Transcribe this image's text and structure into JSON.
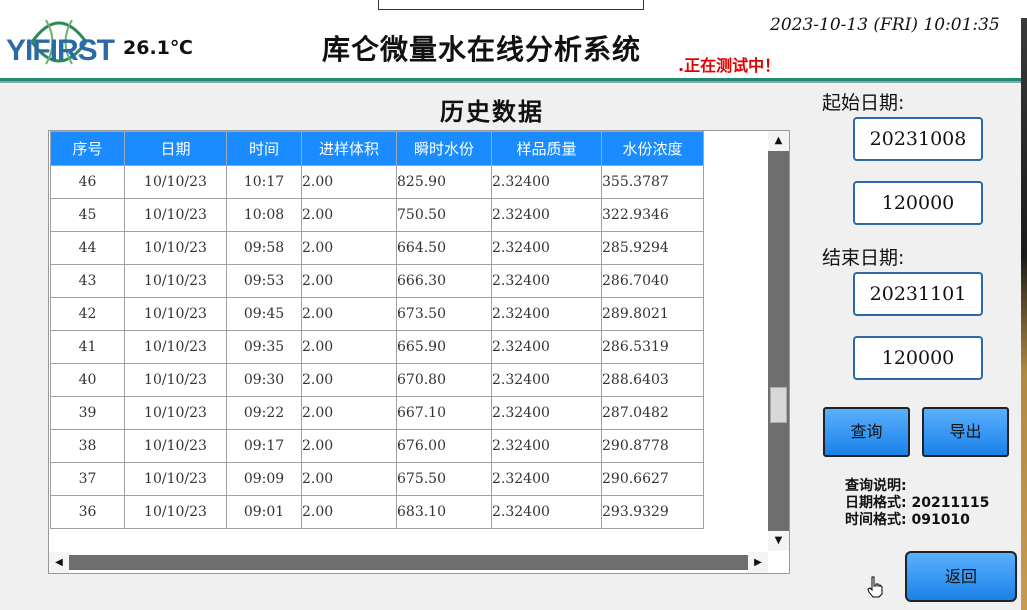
{
  "header": {
    "logo_text": "YIFIRST",
    "temperature": "26.1℃",
    "title": "库仑微量水在线分析系统",
    "status": ".正在测试中！",
    "datetime": "2023-10-13 (FRI) 10:01:35"
  },
  "history": {
    "title": "历史数据",
    "columns": [
      "序号",
      "日期",
      "时间",
      "进样体积",
      "瞬时水份",
      "样品质量",
      "水份浓度"
    ],
    "rows": [
      [
        "46",
        "10/10/23",
        "10:17",
        "2.00",
        "825.90",
        "2.32400",
        "355.3787"
      ],
      [
        "45",
        "10/10/23",
        "10:08",
        "2.00",
        "750.50",
        "2.32400",
        "322.9346"
      ],
      [
        "44",
        "10/10/23",
        "09:58",
        "2.00",
        "664.50",
        "2.32400",
        "285.9294"
      ],
      [
        "43",
        "10/10/23",
        "09:53",
        "2.00",
        "666.30",
        "2.32400",
        "286.7040"
      ],
      [
        "42",
        "10/10/23",
        "09:45",
        "2.00",
        "673.50",
        "2.32400",
        "289.8021"
      ],
      [
        "41",
        "10/10/23",
        "09:35",
        "2.00",
        "665.90",
        "2.32400",
        "286.5319"
      ],
      [
        "40",
        "10/10/23",
        "09:30",
        "2.00",
        "670.80",
        "2.32400",
        "288.6403"
      ],
      [
        "39",
        "10/10/23",
        "09:22",
        "2.00",
        "667.10",
        "2.32400",
        "287.0482"
      ],
      [
        "38",
        "10/10/23",
        "09:17",
        "2.00",
        "676.00",
        "2.32400",
        "290.8778"
      ],
      [
        "37",
        "10/10/23",
        "09:09",
        "2.00",
        "675.50",
        "2.32400",
        "290.6627"
      ],
      [
        "36",
        "10/10/23",
        "09:01",
        "2.00",
        "683.10",
        "2.32400",
        "293.9329"
      ]
    ]
  },
  "query": {
    "start_label": "起始日期:",
    "start_date": "20231008",
    "start_time": "120000",
    "end_label": "结束日期:",
    "end_date": "20231101",
    "end_time": "120000",
    "query_button": "查询",
    "export_button": "导出",
    "help_title": "查询说明:",
    "help_date": "日期格式: 20211115",
    "help_time": "时间格式: 091010",
    "back_button": "返回"
  },
  "colors": {
    "header_accent": "#1e8a6f",
    "table_header": "#1a8cff",
    "button": "#1a82e8",
    "status_red": "#e00000"
  }
}
